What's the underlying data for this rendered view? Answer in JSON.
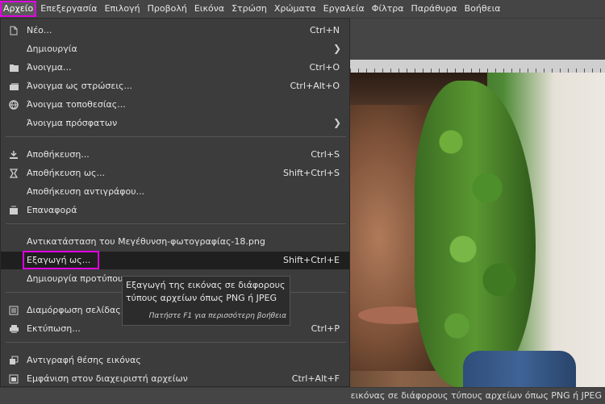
{
  "menubar": {
    "items": [
      "Αρχείο",
      "Επεξεργασία",
      "Επιλογή",
      "Προβολή",
      "Εικόνα",
      "Στρώση",
      "Χρώματα",
      "Εργαλεία",
      "Φίλτρα",
      "Παράθυρα",
      "Βοήθεια"
    ],
    "active_index": 0
  },
  "file_menu": {
    "items": [
      {
        "label": "Νέο...",
        "shortcut": "Ctrl+N",
        "icon": "new-file-icon"
      },
      {
        "label": "Δημιουργία",
        "shortcut": "",
        "icon": "",
        "submenu": true
      },
      {
        "label": "Άνοιγμα...",
        "shortcut": "Ctrl+O",
        "icon": "open-icon"
      },
      {
        "label": "Άνοιγμα ως στρώσεις...",
        "shortcut": "Ctrl+Alt+O",
        "icon": "open-as-layers-icon"
      },
      {
        "label": "Άνοιγμα τοποθεσίας...",
        "shortcut": "",
        "icon": "globe-icon"
      },
      {
        "label": "Άνοιγμα πρόσφατων",
        "shortcut": "",
        "icon": "",
        "submenu": true
      },
      {
        "label": "Αποθήκευση...",
        "shortcut": "Ctrl+S",
        "icon": "save-icon"
      },
      {
        "label": "Αποθήκευση ως...",
        "shortcut": "Shift+Ctrl+S",
        "icon": "save-as-icon"
      },
      {
        "label": "Αποθήκευση αντιγράφου...",
        "shortcut": "",
        "icon": ""
      },
      {
        "label": "Επαναφορά",
        "shortcut": "",
        "icon": "revert-icon"
      },
      {
        "label": "Αντικατάσταση του Μεγέθυνση-φωτογραφίας-18.png",
        "shortcut": "",
        "icon": ""
      },
      {
        "label": "Εξαγωγή ως...",
        "shortcut": "Shift+Ctrl+E",
        "icon": "",
        "highlighted": true
      },
      {
        "label": "Δημιουργία προτύπου",
        "shortcut": "",
        "icon": ""
      },
      {
        "label": "Διαμόρφωση σελίδας...",
        "shortcut": "",
        "icon": "page-setup-icon"
      },
      {
        "label": "Εκτύπωση...",
        "shortcut": "Ctrl+P",
        "icon": "print-icon"
      },
      {
        "label": "Αντιγραφή θέσης εικόνας",
        "shortcut": "",
        "icon": "copy-location-icon"
      },
      {
        "label": "Εμφάνιση στον διαχειριστή αρχείων",
        "shortcut": "Ctrl+Alt+F",
        "icon": "file-manager-icon"
      }
    ]
  },
  "tooltip": {
    "line1": "Εξαγωγή της εικόνας σε διάφορους",
    "line2": "τύπους αρχείων όπως PNG ή JPEG",
    "hint": "Πατήστε F1 για περισσότερη βοήθεια"
  },
  "status": {
    "text": "εικόνας σε διάφορους τύπους αρχείων όπως PNG ή JPEG"
  },
  "colors": {
    "highlight_outline": "#e000e0",
    "menu_bg": "#3c3c3c",
    "hover_bg": "#1f1f1f"
  }
}
